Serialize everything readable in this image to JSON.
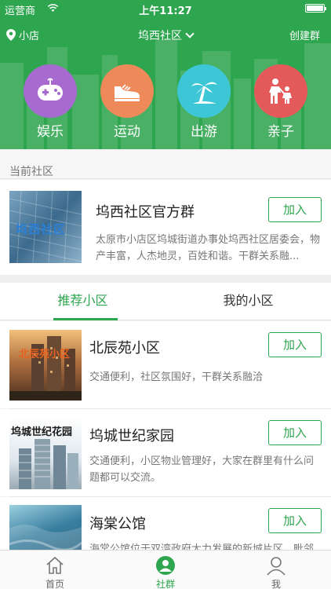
{
  "status_bar": {
    "carrier": "运营商",
    "time": "上午11:27"
  },
  "nav": {
    "location": "小店",
    "title": "坞西社区",
    "create_label": "创建群"
  },
  "categories": [
    {
      "label": "娱乐",
      "icon": "gamepad-icon",
      "color": "#a76ad1"
    },
    {
      "label": "运动",
      "icon": "sneaker-icon",
      "color": "#ee8a5a"
    },
    {
      "label": "出游",
      "icon": "palm-tree-icon",
      "color": "#3cc6d6"
    },
    {
      "label": "亲子",
      "icon": "parent-child-icon",
      "color": "#e45a5a"
    }
  ],
  "current": {
    "section_title": "当前社区",
    "name": "坞西社区官方群",
    "thumb_text": "坞西社区",
    "desc": "太原市小店区坞城街道办事处坞西社区居委会，物产丰富，人杰地灵，百姓和谐。干群关系融...",
    "join_label": "加入"
  },
  "tabs": {
    "recommended": "推荐小区",
    "mine": "我的小区"
  },
  "communities": [
    {
      "name": "北辰苑小区",
      "thumb_text": "北辰苑小区",
      "desc": "交通便利，社区氛围好，干群关系融洽",
      "join_label": "加入"
    },
    {
      "name": "坞城世纪家园",
      "thumb_text": "坞城世纪花园",
      "desc": "交通便利，小区物业管理好，大家在群里有什么问题都可以交流。",
      "join_label": "加入"
    },
    {
      "name": "海棠公馆",
      "thumb_text": "",
      "desc": "海棠公馆位于双湾政府大力发展的新城片区，毗邻",
      "join_label": "加入"
    }
  ],
  "tabbar": [
    {
      "label": "首页",
      "icon": "home-icon"
    },
    {
      "label": "社群",
      "icon": "community-icon"
    },
    {
      "label": "我",
      "icon": "user-icon"
    }
  ],
  "colors": {
    "brand_green": "#2ea54f"
  }
}
